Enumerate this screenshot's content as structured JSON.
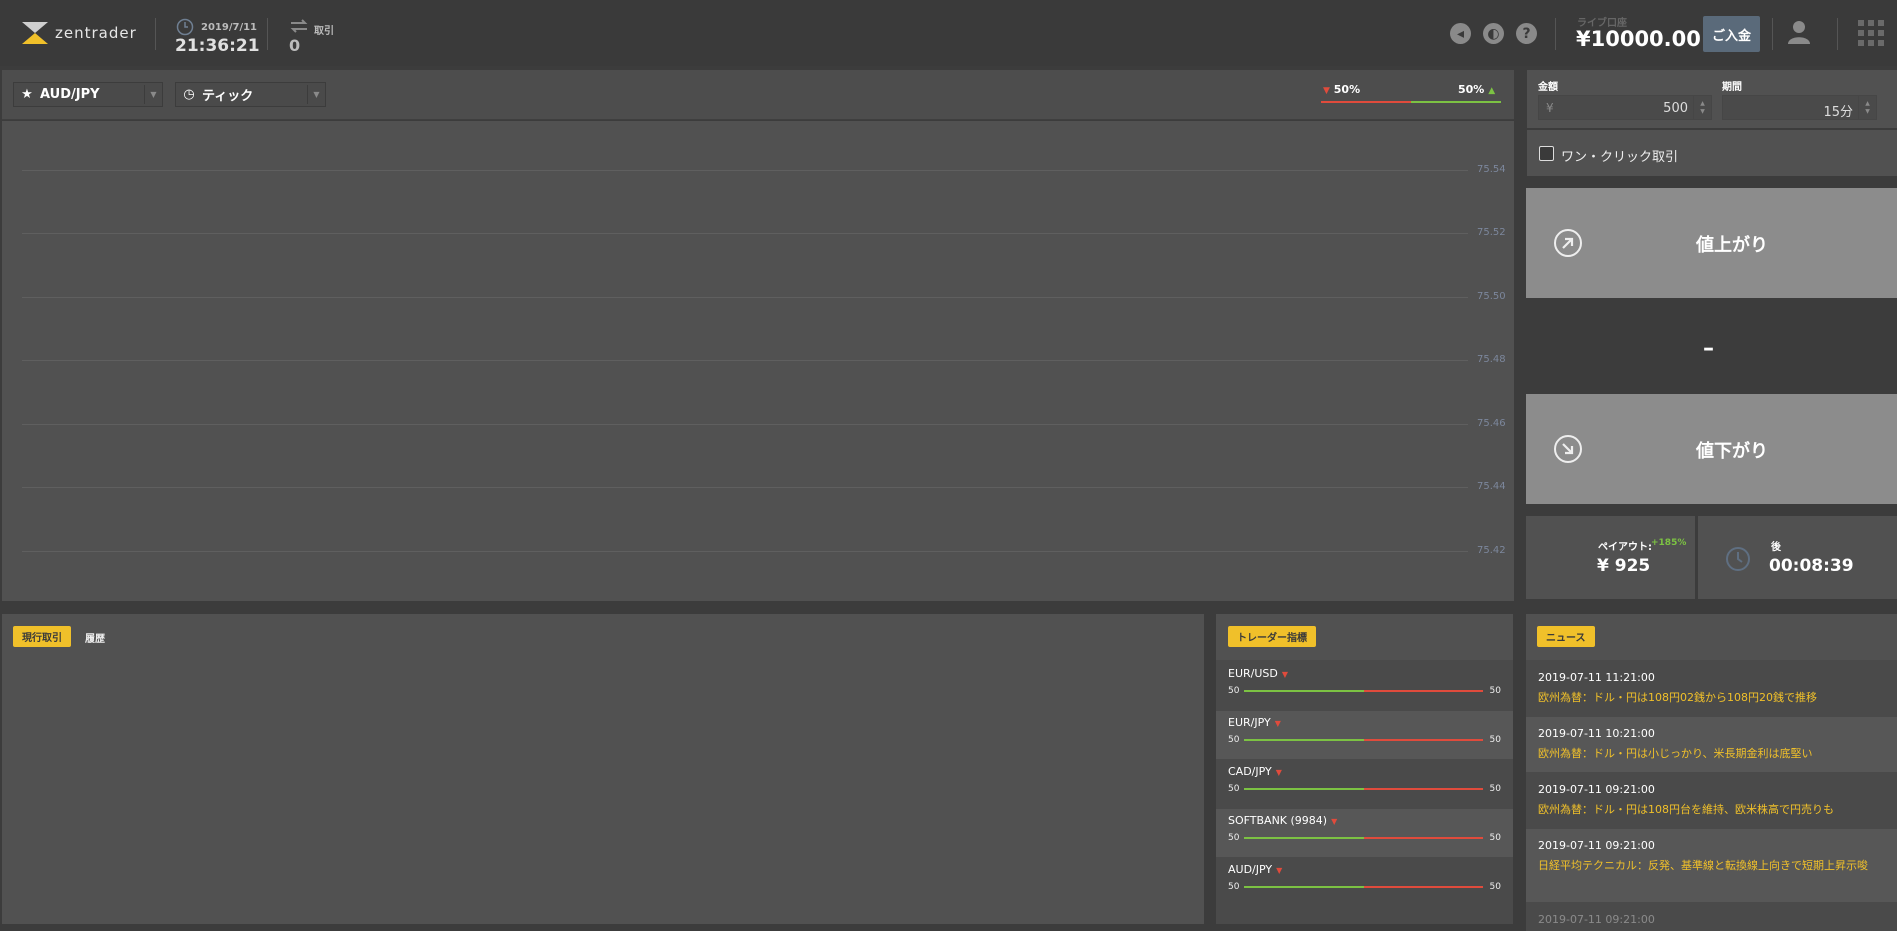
{
  "header": {
    "logo_text": "zentrader",
    "date": "2019/7/11",
    "time": "21:36:21",
    "trades_label": "取引",
    "trades_count": "0",
    "balance_label": "ライブ口座",
    "balance": "¥10000.00",
    "deposit_label": "ご入金"
  },
  "toolbar": {
    "asset": "AUD/JPY",
    "chart_type": "ティック",
    "sentiment_down": "50%",
    "sentiment_up": "50%"
  },
  "chart": {
    "y_ticks": [
      "75.54",
      "75.52",
      "75.50",
      "75.48",
      "75.46",
      "75.44",
      "75.42"
    ]
  },
  "trade": {
    "amount_label": "金額",
    "currency": "¥",
    "amount": "500",
    "period_label": "期間",
    "period": "15分",
    "one_click_label": "ワン・クリック取引",
    "call_label": "値上がり",
    "put_label": "値下がり",
    "price_placeholder": "–",
    "payout_label": "ペイアウト:",
    "payout_pct": "+185%",
    "payout_value": "¥ 925",
    "expiry_label": "後",
    "expiry_value": "00:08:39"
  },
  "trades": {
    "tab_current": "現行取引",
    "tab_history": "履歴"
  },
  "trader_indicator": {
    "title": "トレーダー指標",
    "items": [
      {
        "name": "EUR/USD",
        "left": "50",
        "right": "50"
      },
      {
        "name": "EUR/JPY",
        "left": "50",
        "right": "50"
      },
      {
        "name": "CAD/JPY",
        "left": "50",
        "right": "50"
      },
      {
        "name": "SOFTBANK (9984)",
        "left": "50",
        "right": "50"
      },
      {
        "name": "AUD/JPY",
        "left": "50",
        "right": "50"
      }
    ]
  },
  "news": {
    "title": "ニュース",
    "items": [
      {
        "time": "2019-07-11 11:21:00",
        "title": "欧州為替：ドル・円は108円02銭から108円20銭で推移"
      },
      {
        "time": "2019-07-11 10:21:00",
        "title": "欧州為替：ドル・円は小じっかり、米長期金利は底堅い"
      },
      {
        "time": "2019-07-11 09:21:00",
        "title": "欧州為替：ドル・円は108円台を維持、欧米株高で円売りも"
      },
      {
        "time": "2019-07-11 09:21:00",
        "title": "日経平均テクニカル：反発、基準線と転換線上向きで短期上昇示唆"
      },
      {
        "time": "2019-07-11 09:21:00",
        "title": ""
      }
    ]
  },
  "colors": {
    "accent": "#f0c02a",
    "up": "#7cc243",
    "down": "#e04b3c",
    "deposit": "#5a6a7a"
  }
}
